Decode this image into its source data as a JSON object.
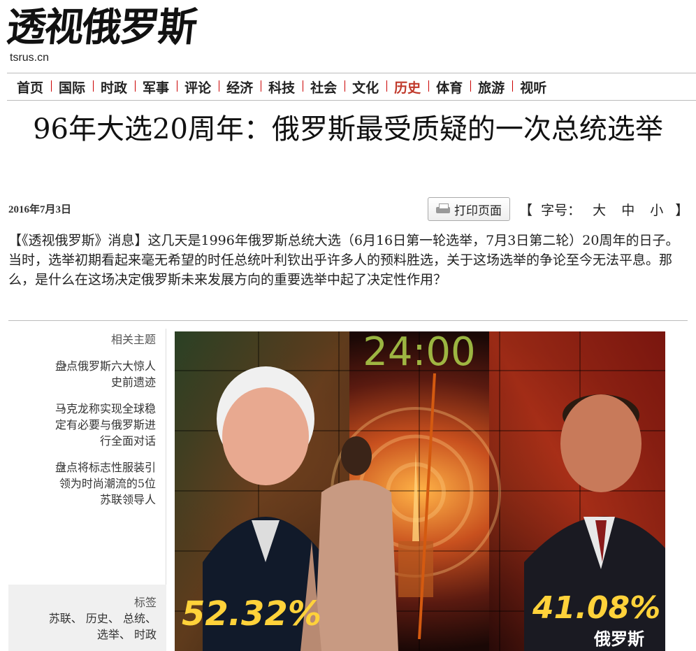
{
  "logo": {
    "calligraphy": "透视俄罗斯",
    "domain": "tsrus.cn"
  },
  "nav": {
    "items": [
      {
        "label": "首页"
      },
      {
        "label": "国际"
      },
      {
        "label": "时政"
      },
      {
        "label": "军事"
      },
      {
        "label": "评论"
      },
      {
        "label": "经济"
      },
      {
        "label": "科技"
      },
      {
        "label": "社会"
      },
      {
        "label": "文化"
      },
      {
        "label": "历史",
        "active": true
      },
      {
        "label": "体育"
      },
      {
        "label": "旅游"
      },
      {
        "label": "视听"
      }
    ],
    "active_color": "#c0392b"
  },
  "article": {
    "title": "96年大选20周年：俄罗斯最受质疑的一次总统选举",
    "date": "2016年7月3日",
    "print_label": "打印页面",
    "fontsize": {
      "open": "【",
      "label": "字号：",
      "large": "大",
      "medium": "中",
      "small": "小",
      "close": "】"
    },
    "lead": "【《透视俄罗斯》消息】这几天是1996年俄罗斯总统大选（6月16日第一轮选举，7月3日第二轮）20周年的日子。当时，选举初期看起来毫无希望的时任总统叶利钦出乎许多人的预料胜选，关于这场选举的争论至今无法平息。那么，是什么在这场决定俄罗斯未来发展方向的重要选举中起了决定性作用？"
  },
  "sidebar": {
    "related_heading": "相关主题",
    "related": [
      "盘点俄罗斯六大惊人史前遗迹",
      "马克龙称实现全球稳定有必要与俄罗斯进行全面对话",
      "盘点将标志性服装引领为时尚潮流的5位苏联领导人"
    ],
    "tags_heading": "标签",
    "tags": [
      "苏联",
      "历史",
      "总统",
      "选举",
      "时政"
    ]
  },
  "photo": {
    "clock": "24:00",
    "left_percent": "52.32%",
    "right_percent": "41.08%",
    "watermark": "俄罗斯"
  }
}
